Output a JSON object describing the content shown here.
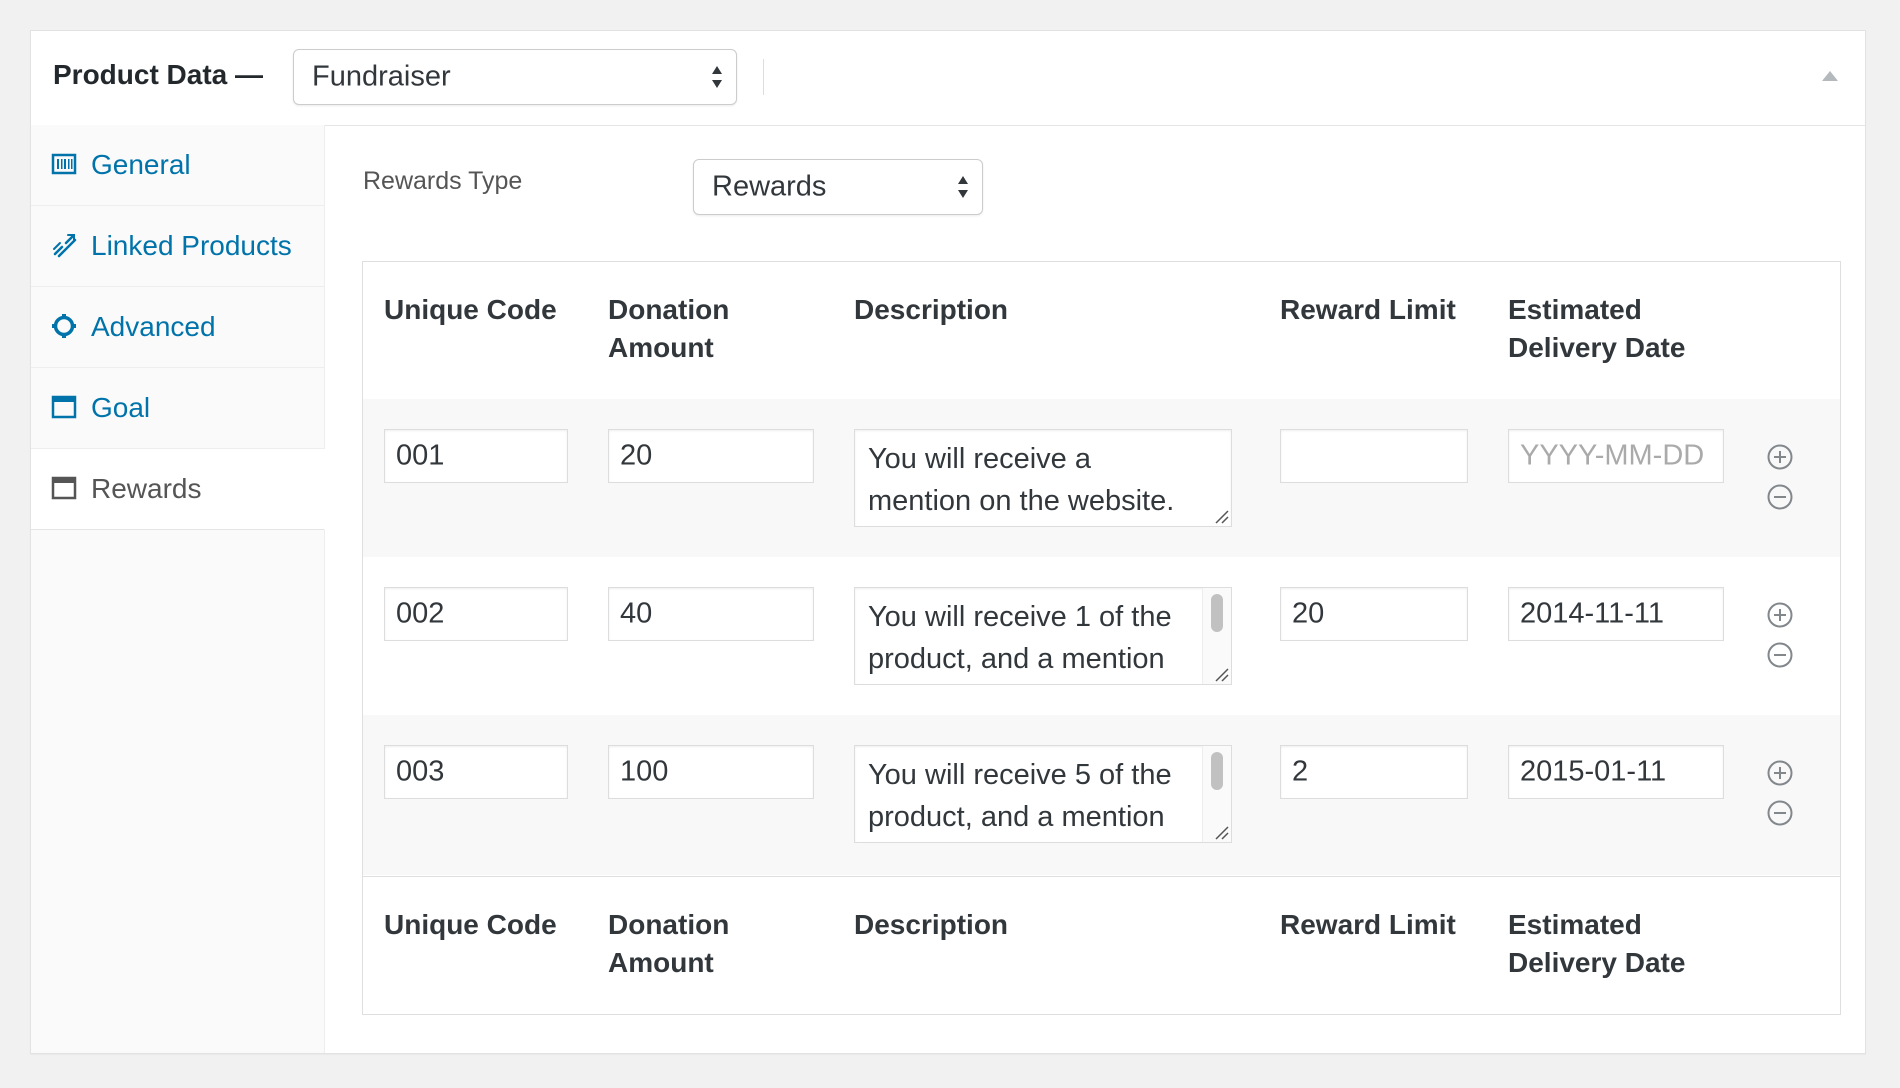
{
  "header": {
    "title": "Product Data —",
    "product_type": "Fundraiser"
  },
  "tabs": [
    {
      "label": "General",
      "icon": "barcode-icon",
      "active": false
    },
    {
      "label": "Linked Products",
      "icon": "link-icon",
      "active": false
    },
    {
      "label": "Advanced",
      "icon": "gear-icon",
      "active": false
    },
    {
      "label": "Goal",
      "icon": "window-icon",
      "active": false
    },
    {
      "label": "Rewards",
      "icon": "window-icon",
      "active": true
    }
  ],
  "rewards_type": {
    "label": "Rewards Type",
    "value": "Rewards"
  },
  "table": {
    "columns": [
      "Unique Code",
      "Donation Amount",
      "Description",
      "Reward Limit",
      "Estimated Delivery Date"
    ],
    "column_lines": [
      [
        "Unique Code"
      ],
      [
        "Donation",
        "Amount"
      ],
      [
        "Description"
      ],
      [
        "Reward Limit"
      ],
      [
        "Estimated",
        "Delivery Date"
      ]
    ],
    "date_placeholder": "YYYY-MM-DD",
    "rows": [
      {
        "code": "001",
        "amount": "20",
        "description": "You will receive a mention on the website.",
        "limit": "",
        "date": ""
      },
      {
        "code": "002",
        "amount": "40",
        "description": "You will receive 1 of the product, and a mention",
        "limit": "20",
        "date": "2014-11-11"
      },
      {
        "code": "003",
        "amount": "100",
        "description": "You will receive 5 of the product, and a mention",
        "limit": "2",
        "date": "2015-01-11"
      }
    ]
  },
  "colors": {
    "link": "#0073aa",
    "active_tab_text": "#555555",
    "border": "#dfdfdf"
  }
}
